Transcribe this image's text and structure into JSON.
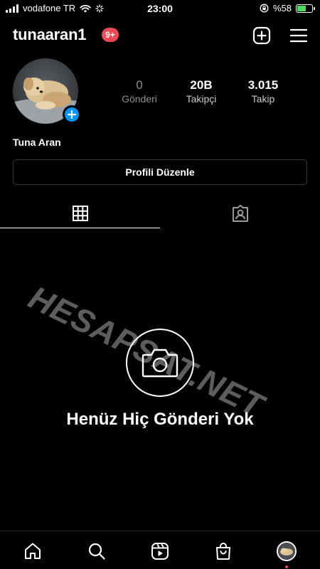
{
  "status_bar": {
    "carrier": "vodafone TR",
    "time": "23:00",
    "battery_text": "%58",
    "battery_level": 0.58,
    "battery_color": "#4cd964",
    "icons": [
      "signal-icon",
      "wifi-icon",
      "loading-icon",
      "orientation-lock-icon",
      "battery-icon"
    ]
  },
  "header": {
    "username": "tunaaran1",
    "notification_badge": "9+",
    "badge_color": "#ed4956",
    "icons": [
      "new-post-icon",
      "menu-icon"
    ]
  },
  "profile": {
    "display_name": "Tuna Aran",
    "stats": [
      {
        "value": "0",
        "label": "Gönderi"
      },
      {
        "value": "20B",
        "label": "Takipçi"
      },
      {
        "value": "3.015",
        "label": "Takip"
      }
    ],
    "edit_button": "Profili Düzenle",
    "add_story_color": "#0095f6"
  },
  "tabs": [
    {
      "icon": "grid-icon",
      "active": true
    },
    {
      "icon": "tagged-icon",
      "active": false
    }
  ],
  "watermark": "HESAPSAT.NET",
  "empty_state": {
    "icon": "camera-icon",
    "title": "Henüz Hiç Gönderi Yok"
  },
  "bottom_nav": [
    {
      "icon": "home-icon"
    },
    {
      "icon": "search-icon"
    },
    {
      "icon": "reels-icon"
    },
    {
      "icon": "shop-icon"
    },
    {
      "icon": "profile-avatar-icon"
    }
  ]
}
